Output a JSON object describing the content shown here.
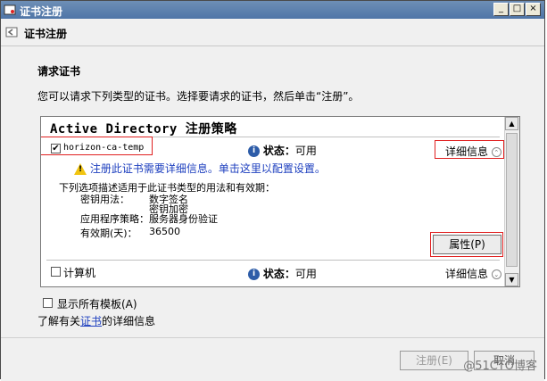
{
  "window": {
    "title": "证书注册",
    "controls": [
      "_",
      "□",
      "×"
    ]
  },
  "header": {
    "title": "证书注册"
  },
  "main": {
    "heading": "请求证书",
    "description": "您可以请求下列类型的证书。选择要请求的证书，然后单击“注册”。"
  },
  "policy": {
    "title": "Active Directory 注册策略",
    "templates": [
      {
        "name": "horizon-ca-temp",
        "checked": true,
        "status_label": "状态：",
        "status_value": "可用",
        "details_label": "详细信息",
        "warning": "注册此证书需要详细信息。单击这里以配置设置。",
        "desc": "下列选项描述适用于此证书类型的用法和有效期：",
        "key_usage_label": "密钥用法：",
        "key_usage_values": [
          "数字签名",
          "密钥加密"
        ],
        "app_policy_label": "应用程序策略：",
        "app_policy_value": "服务器身份验证",
        "validity_label": "有效期(天)：",
        "validity_value": "36500",
        "properties_button": "属性(P)"
      },
      {
        "name": "计算机",
        "checked": false,
        "status_label": "状态：",
        "status_value": "可用",
        "details_label": "详细信息"
      }
    ]
  },
  "options": {
    "show_all_label": "显示所有模板(A)",
    "learn_prefix": "了解有关",
    "learn_link": "证书",
    "learn_suffix": "的详细信息"
  },
  "footer": {
    "enroll_button": "注册(E)",
    "cancel_button": "取消",
    "watermark": "@51CTO博客"
  },
  "colors": {
    "title_bar": "#4f75a7",
    "link": "#1d3fbf",
    "highlight": "#e02020",
    "warning": "#f1c40f"
  }
}
